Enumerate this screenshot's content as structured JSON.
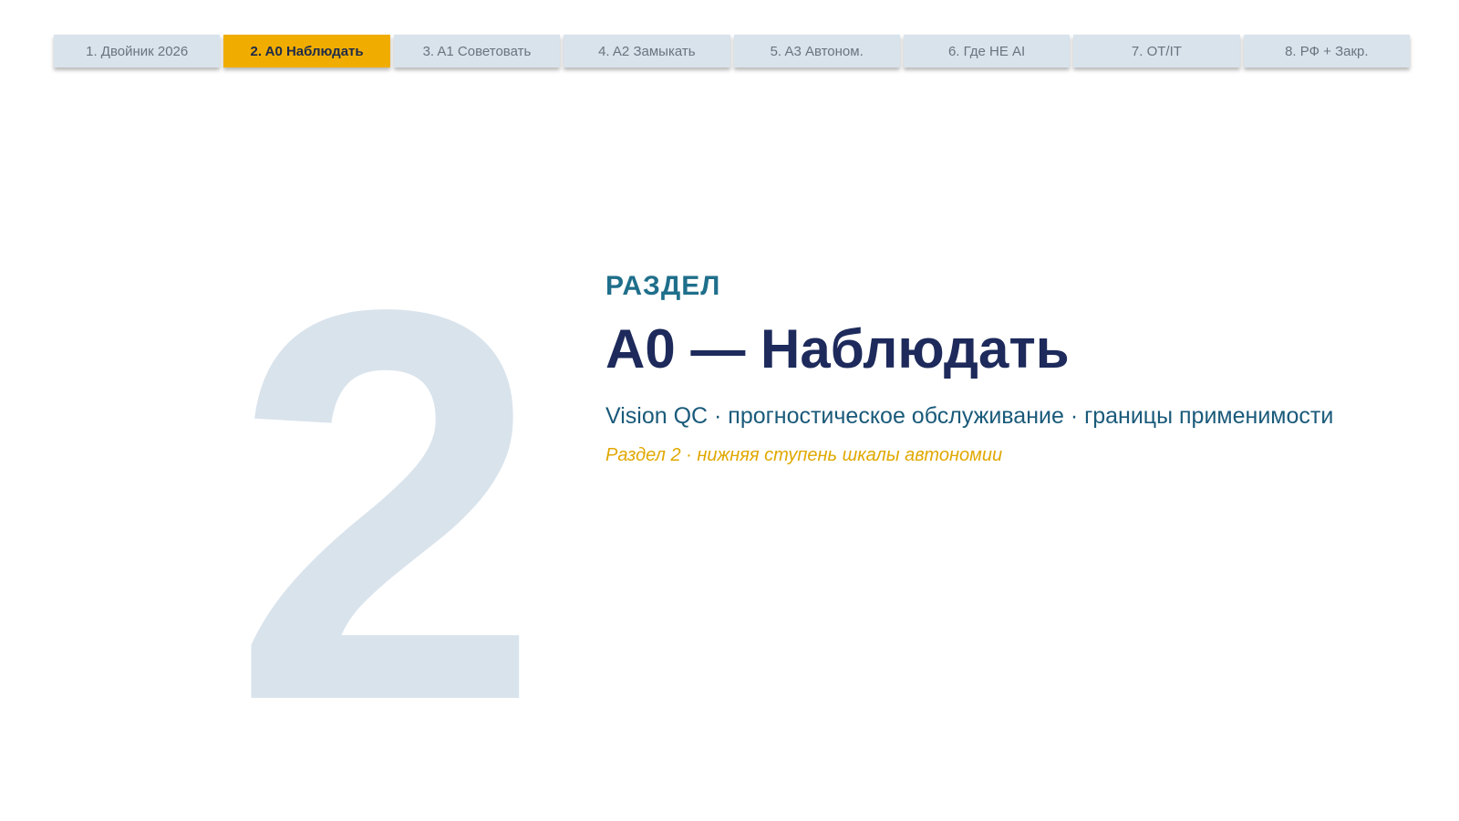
{
  "nav": {
    "tabs": [
      {
        "label": "1. Двойник 2026",
        "active": false
      },
      {
        "label": "2. A0 Наблюдать",
        "active": true
      },
      {
        "label": "3. A1 Советовать",
        "active": false
      },
      {
        "label": "4. A2 Замыкать",
        "active": false
      },
      {
        "label": "5. A3 Автоном.",
        "active": false
      },
      {
        "label": "6. Где НЕ AI",
        "active": false
      },
      {
        "label": "7. OT/IT",
        "active": false
      },
      {
        "label": "8. РФ + Закр.",
        "active": false
      }
    ],
    "active_color": "#f0ad00",
    "inactive_color": "#d9e3ec"
  },
  "section": {
    "number": "2",
    "kicker": "РАЗДЕЛ",
    "title": "A0 — Наблюдать",
    "subtitle": "Vision QC · прогностическое обслуживание · границы применимости",
    "note": "Раздел 2 · нижняя ступень шкалы автономии"
  },
  "colors": {
    "number": "#d9e3ec",
    "kicker": "#1f6f8b",
    "title": "#1d2a5b",
    "subtitle": "#1a5a7a",
    "note": "#e0a800"
  }
}
